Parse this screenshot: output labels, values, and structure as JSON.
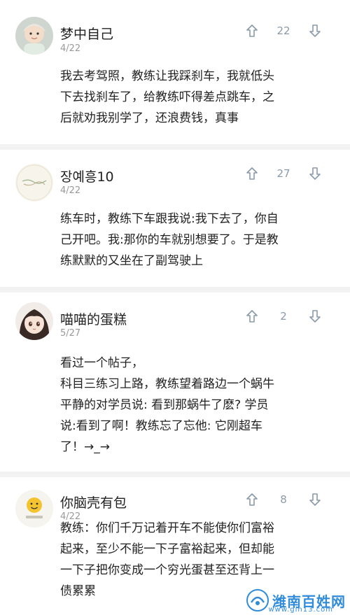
{
  "comments": [
    {
      "username": "梦中自己",
      "date": "4/22",
      "votes": "22",
      "lines": [
        "我去考驾照，教练让我踩刹车，我就低头",
        "下去找刹车了，给教练吓得差点跳车，之",
        "后就劝我别学了，还浪费钱，真事"
      ]
    },
    {
      "username": "장예흥10",
      "date": "4/22",
      "votes": "27",
      "lines": [
        "练车时，教练下车跟我说:我下去了，你自",
        "己开吧。我:那你的车就别想要了。于是教",
        "练默默的又坐在了副驾驶上"
      ]
    },
    {
      "username": "喵喵的蛋糕",
      "date": "5/27",
      "votes": "2",
      "lines": [
        "看过一个帖子，",
        "科目三练习上路，教练望着路边一个蜗牛",
        "平静的对学员说: 看到那蜗牛了麽? 学员",
        "说:看到了啊！教练忘了忘他:  它刚超车",
        "了！→_→"
      ]
    },
    {
      "username": "你脑壳有包",
      "date": "4/22",
      "votes": "8",
      "lines": [
        "教练：你们千万记着开车不能使你们富裕",
        "起来，至少不能一下子富裕起来，但却能",
        "一下子把你变成一个穷光蛋甚至还背上一",
        "债累累"
      ]
    }
  ],
  "watermark": {
    "text": "潍南百姓网",
    "url": "www.gin13.com"
  },
  "colors": {
    "vote_icon": "#8a9aa8",
    "divider": "#f2f2f2",
    "watermark": "#1a7fd6"
  }
}
